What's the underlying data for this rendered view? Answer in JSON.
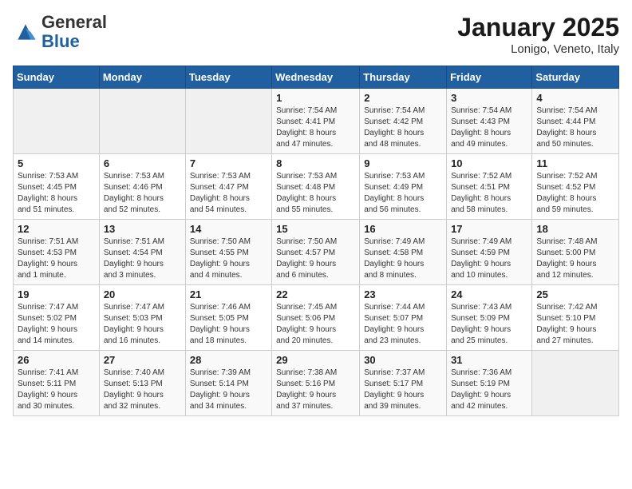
{
  "header": {
    "logo_general": "General",
    "logo_blue": "Blue",
    "month_title": "January 2025",
    "subtitle": "Lonigo, Veneto, Italy"
  },
  "weekdays": [
    "Sunday",
    "Monday",
    "Tuesday",
    "Wednesday",
    "Thursday",
    "Friday",
    "Saturday"
  ],
  "weeks": [
    [
      {
        "day": "",
        "info": ""
      },
      {
        "day": "",
        "info": ""
      },
      {
        "day": "",
        "info": ""
      },
      {
        "day": "1",
        "info": "Sunrise: 7:54 AM\nSunset: 4:41 PM\nDaylight: 8 hours\nand 47 minutes."
      },
      {
        "day": "2",
        "info": "Sunrise: 7:54 AM\nSunset: 4:42 PM\nDaylight: 8 hours\nand 48 minutes."
      },
      {
        "day": "3",
        "info": "Sunrise: 7:54 AM\nSunset: 4:43 PM\nDaylight: 8 hours\nand 49 minutes."
      },
      {
        "day": "4",
        "info": "Sunrise: 7:54 AM\nSunset: 4:44 PM\nDaylight: 8 hours\nand 50 minutes."
      }
    ],
    [
      {
        "day": "5",
        "info": "Sunrise: 7:53 AM\nSunset: 4:45 PM\nDaylight: 8 hours\nand 51 minutes."
      },
      {
        "day": "6",
        "info": "Sunrise: 7:53 AM\nSunset: 4:46 PM\nDaylight: 8 hours\nand 52 minutes."
      },
      {
        "day": "7",
        "info": "Sunrise: 7:53 AM\nSunset: 4:47 PM\nDaylight: 8 hours\nand 54 minutes."
      },
      {
        "day": "8",
        "info": "Sunrise: 7:53 AM\nSunset: 4:48 PM\nDaylight: 8 hours\nand 55 minutes."
      },
      {
        "day": "9",
        "info": "Sunrise: 7:53 AM\nSunset: 4:49 PM\nDaylight: 8 hours\nand 56 minutes."
      },
      {
        "day": "10",
        "info": "Sunrise: 7:52 AM\nSunset: 4:51 PM\nDaylight: 8 hours\nand 58 minutes."
      },
      {
        "day": "11",
        "info": "Sunrise: 7:52 AM\nSunset: 4:52 PM\nDaylight: 8 hours\nand 59 minutes."
      }
    ],
    [
      {
        "day": "12",
        "info": "Sunrise: 7:51 AM\nSunset: 4:53 PM\nDaylight: 9 hours\nand 1 minute."
      },
      {
        "day": "13",
        "info": "Sunrise: 7:51 AM\nSunset: 4:54 PM\nDaylight: 9 hours\nand 3 minutes."
      },
      {
        "day": "14",
        "info": "Sunrise: 7:50 AM\nSunset: 4:55 PM\nDaylight: 9 hours\nand 4 minutes."
      },
      {
        "day": "15",
        "info": "Sunrise: 7:50 AM\nSunset: 4:57 PM\nDaylight: 9 hours\nand 6 minutes."
      },
      {
        "day": "16",
        "info": "Sunrise: 7:49 AM\nSunset: 4:58 PM\nDaylight: 9 hours\nand 8 minutes."
      },
      {
        "day": "17",
        "info": "Sunrise: 7:49 AM\nSunset: 4:59 PM\nDaylight: 9 hours\nand 10 minutes."
      },
      {
        "day": "18",
        "info": "Sunrise: 7:48 AM\nSunset: 5:00 PM\nDaylight: 9 hours\nand 12 minutes."
      }
    ],
    [
      {
        "day": "19",
        "info": "Sunrise: 7:47 AM\nSunset: 5:02 PM\nDaylight: 9 hours\nand 14 minutes."
      },
      {
        "day": "20",
        "info": "Sunrise: 7:47 AM\nSunset: 5:03 PM\nDaylight: 9 hours\nand 16 minutes."
      },
      {
        "day": "21",
        "info": "Sunrise: 7:46 AM\nSunset: 5:05 PM\nDaylight: 9 hours\nand 18 minutes."
      },
      {
        "day": "22",
        "info": "Sunrise: 7:45 AM\nSunset: 5:06 PM\nDaylight: 9 hours\nand 20 minutes."
      },
      {
        "day": "23",
        "info": "Sunrise: 7:44 AM\nSunset: 5:07 PM\nDaylight: 9 hours\nand 23 minutes."
      },
      {
        "day": "24",
        "info": "Sunrise: 7:43 AM\nSunset: 5:09 PM\nDaylight: 9 hours\nand 25 minutes."
      },
      {
        "day": "25",
        "info": "Sunrise: 7:42 AM\nSunset: 5:10 PM\nDaylight: 9 hours\nand 27 minutes."
      }
    ],
    [
      {
        "day": "26",
        "info": "Sunrise: 7:41 AM\nSunset: 5:11 PM\nDaylight: 9 hours\nand 30 minutes."
      },
      {
        "day": "27",
        "info": "Sunrise: 7:40 AM\nSunset: 5:13 PM\nDaylight: 9 hours\nand 32 minutes."
      },
      {
        "day": "28",
        "info": "Sunrise: 7:39 AM\nSunset: 5:14 PM\nDaylight: 9 hours\nand 34 minutes."
      },
      {
        "day": "29",
        "info": "Sunrise: 7:38 AM\nSunset: 5:16 PM\nDaylight: 9 hours\nand 37 minutes."
      },
      {
        "day": "30",
        "info": "Sunrise: 7:37 AM\nSunset: 5:17 PM\nDaylight: 9 hours\nand 39 minutes."
      },
      {
        "day": "31",
        "info": "Sunrise: 7:36 AM\nSunset: 5:19 PM\nDaylight: 9 hours\nand 42 minutes."
      },
      {
        "day": "",
        "info": ""
      }
    ]
  ]
}
